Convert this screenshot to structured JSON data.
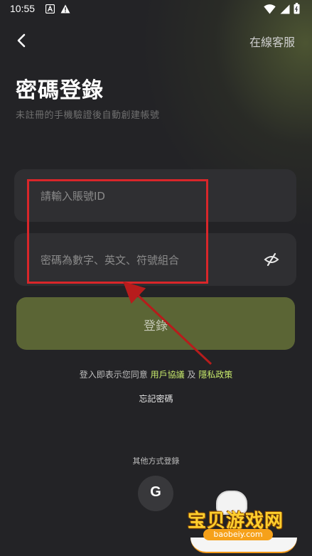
{
  "status_bar": {
    "time": "10:55",
    "icons": [
      "a-icon",
      "warning-icon",
      "wifi-icon",
      "signal-icon",
      "battery-icon"
    ]
  },
  "nav": {
    "back_icon": "chevron-left-icon",
    "service_label": "在線客服"
  },
  "header": {
    "title": "密碼登錄",
    "subtitle": "未註冊的手機驗證後自動創建帳號"
  },
  "form": {
    "account_placeholder": "請輸入賬號ID",
    "password_placeholder": "密碼為數字、英文、符號組合",
    "eye_icon": "eye-off-icon",
    "login_label": "登錄"
  },
  "agreement": {
    "prefix": "登入即表示您同意",
    "user_agreement": "用戶協議",
    "and": "及",
    "privacy_policy": "隱私政策"
  },
  "forgot_label": "忘記密碼",
  "other_methods": {
    "label": "其他方式登錄",
    "google_letter": "G"
  },
  "annotation": {
    "box_color": "#d9262a",
    "arrow_color": "#b71c1c"
  },
  "watermark": {
    "text": "宝贝游戏网",
    "url": "baobeiy.com"
  },
  "colors": {
    "background": "#232326",
    "field": "#2f2f32",
    "login_button": "#5b6535",
    "link": "#c6e86b"
  }
}
